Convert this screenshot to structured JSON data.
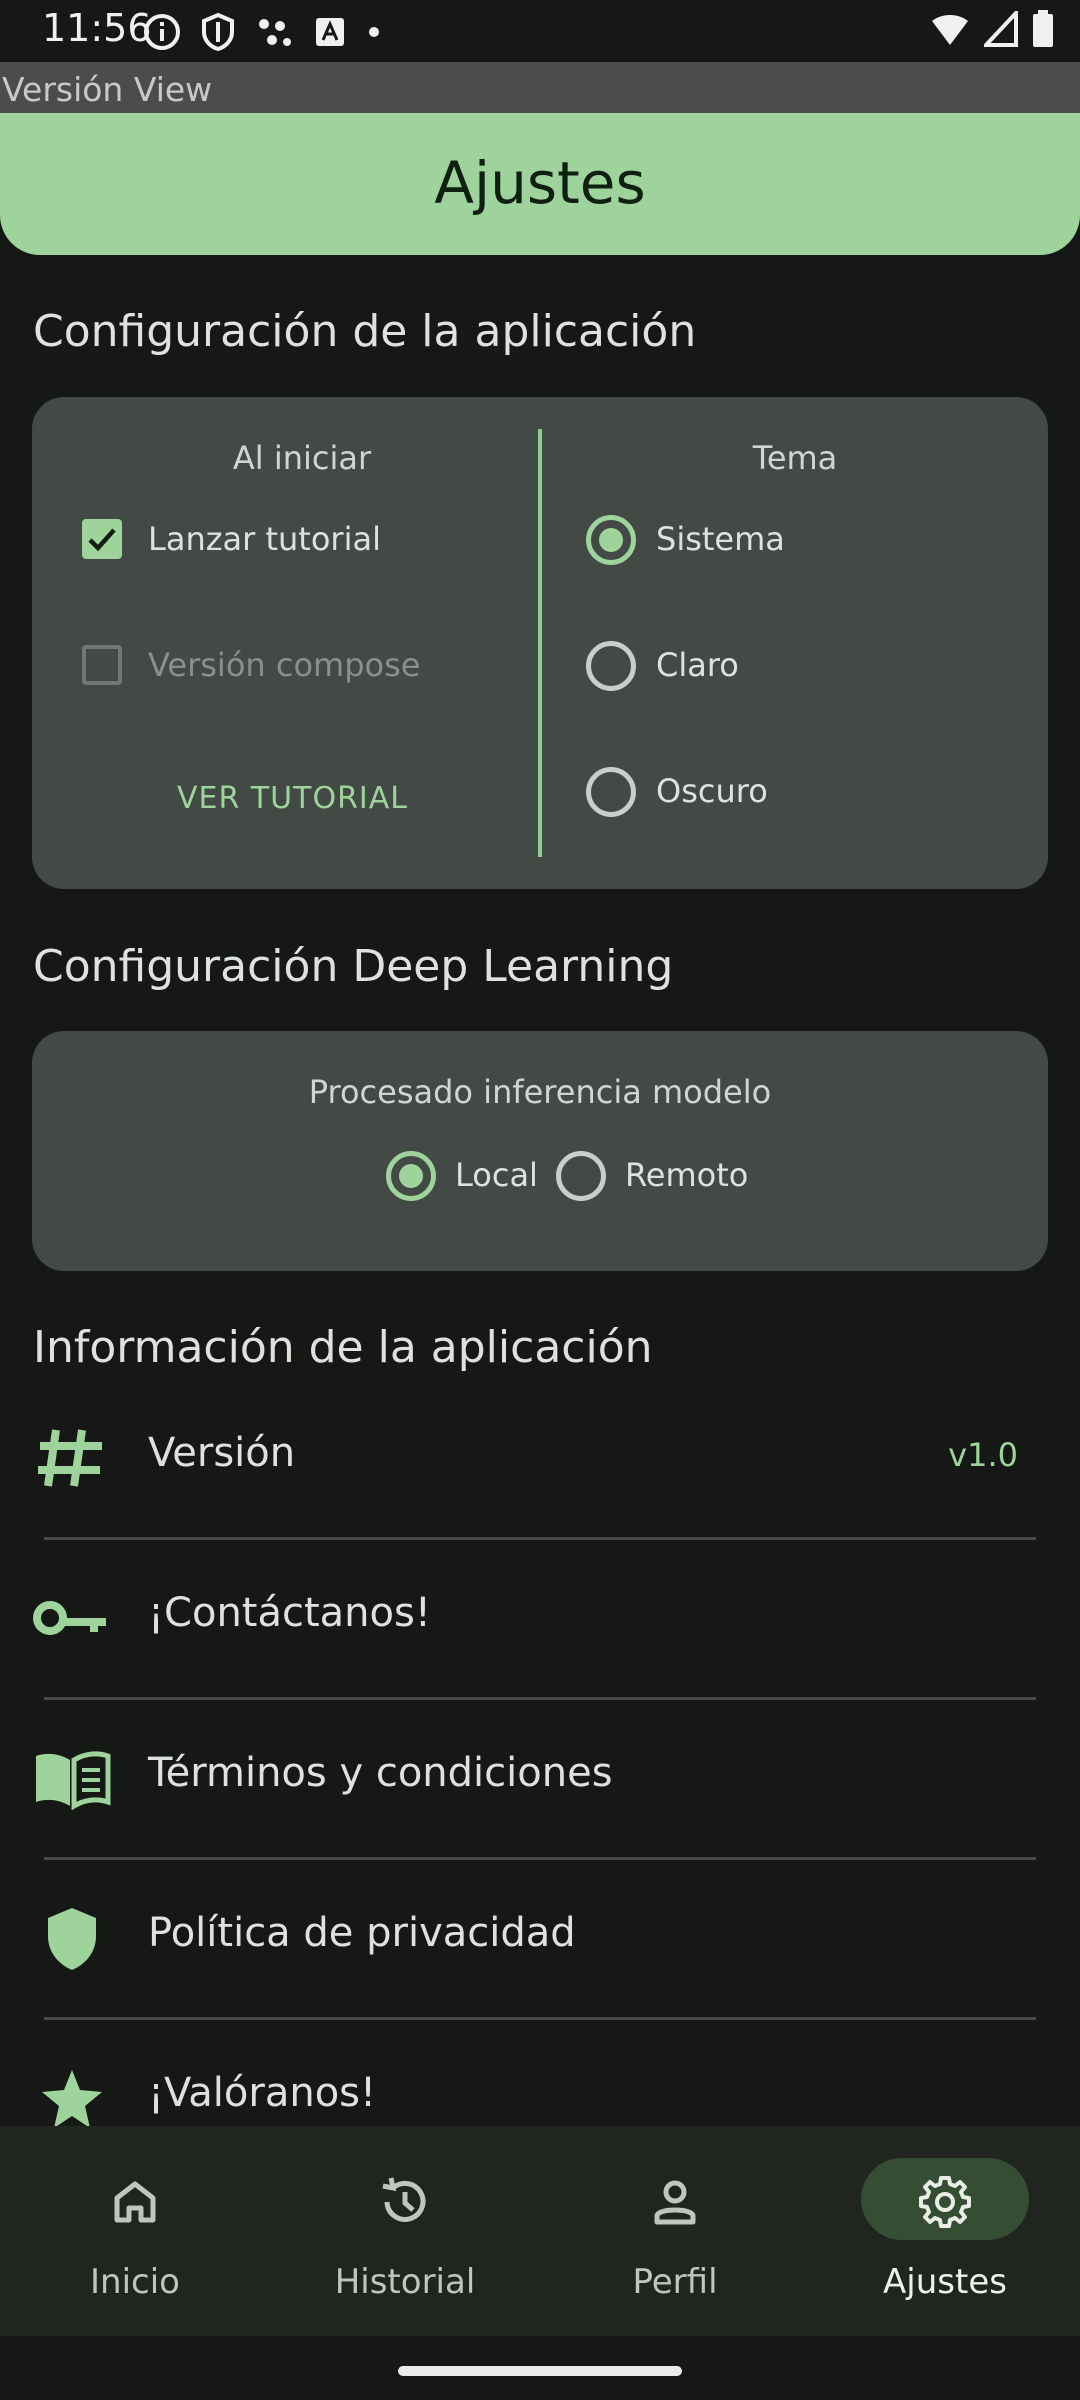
{
  "status_bar": {
    "time": "11:56"
  },
  "version_bar": {
    "label": "Versión View"
  },
  "header": {
    "title": "Ajustes"
  },
  "app_config": {
    "section_title": "Configuración de la aplicación",
    "startup": {
      "title": "Al iniciar",
      "launch_tutorial": {
        "label": "Lanzar tutorial",
        "checked": true
      },
      "compose_version": {
        "label": "Versión compose",
        "checked": false,
        "enabled": false
      },
      "view_tutorial_button": "VER TUTORIAL"
    },
    "theme": {
      "title": "Tema",
      "options": [
        "Sistema",
        "Claro",
        "Oscuro"
      ],
      "selected": "Sistema"
    }
  },
  "dl_config": {
    "section_title": "Configuración Deep Learning",
    "inference": {
      "title": "Procesado inferencia modelo",
      "options": [
        "Local",
        "Remoto"
      ],
      "selected": "Local"
    }
  },
  "app_info": {
    "section_title": "Información de la aplicación",
    "items": [
      {
        "label": "Versión",
        "value": "v1.0",
        "icon": "hash-icon"
      },
      {
        "label": "¡Contáctanos!",
        "icon": "key-icon"
      },
      {
        "label": "Términos y condiciones",
        "icon": "book-icon"
      },
      {
        "label": "Política de privacidad",
        "icon": "shield-icon"
      },
      {
        "label": "¡Valóranos!",
        "icon": "star-icon"
      }
    ]
  },
  "bottom_nav": {
    "items": [
      {
        "label": "Inicio",
        "icon": "home-icon"
      },
      {
        "label": "Historial",
        "icon": "history-icon"
      },
      {
        "label": "Perfil",
        "icon": "person-icon"
      },
      {
        "label": "Ajustes",
        "icon": "gear-icon"
      }
    ],
    "active": "Ajustes"
  },
  "colors": {
    "accent": "#9ed49c",
    "background": "#151815",
    "card": "#434944"
  }
}
